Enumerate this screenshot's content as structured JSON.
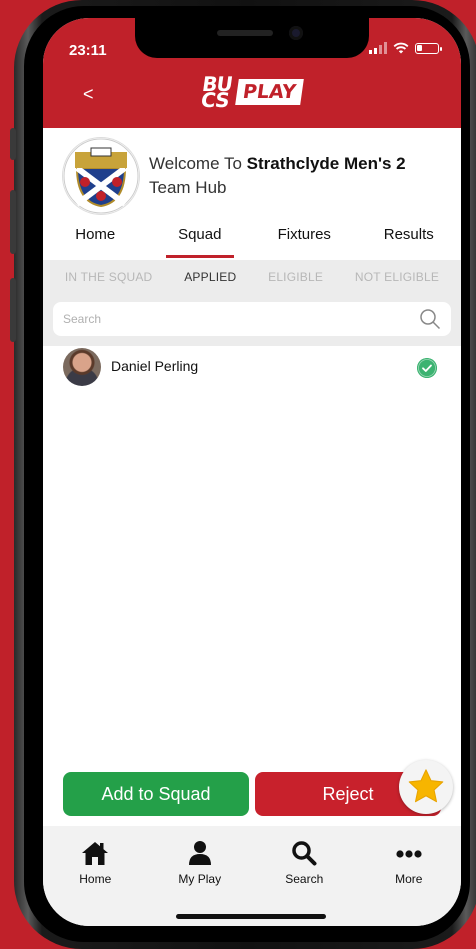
{
  "status_bar": {
    "time": "23:11"
  },
  "header": {
    "back_label": "<",
    "logo": {
      "top": "BU CS",
      "play": "PLAY"
    }
  },
  "team": {
    "welcome": "Welcome To",
    "name": "Strathclyde Men's 2",
    "hub": "Team Hub"
  },
  "tabs": [
    {
      "label": "Home"
    },
    {
      "label": "Squad",
      "active": true
    },
    {
      "label": "Fixtures"
    },
    {
      "label": "Results"
    }
  ],
  "subtabs": [
    {
      "label": "IN THE SQUAD"
    },
    {
      "label": "APPLIED",
      "active": true
    },
    {
      "label": "ELIGIBLE"
    },
    {
      "label": "NOT ELIGIBLE"
    }
  ],
  "search": {
    "placeholder": "Search",
    "value": ""
  },
  "members": [
    {
      "name": "Daniel Perling",
      "selected": true
    }
  ],
  "actions": {
    "add_label": "Add to Squad",
    "reject_label": "Reject"
  },
  "bottom_nav": [
    {
      "label": "Home",
      "icon": "home-icon"
    },
    {
      "label": "My Play",
      "icon": "person-icon"
    },
    {
      "label": "Search",
      "icon": "search-icon"
    },
    {
      "label": "More",
      "icon": "more-icon"
    }
  ],
  "colors": {
    "brand_red": "#c0212a",
    "add_green": "#24a049",
    "check_green": "#3cb371",
    "star_yellow": "#f7b500"
  }
}
